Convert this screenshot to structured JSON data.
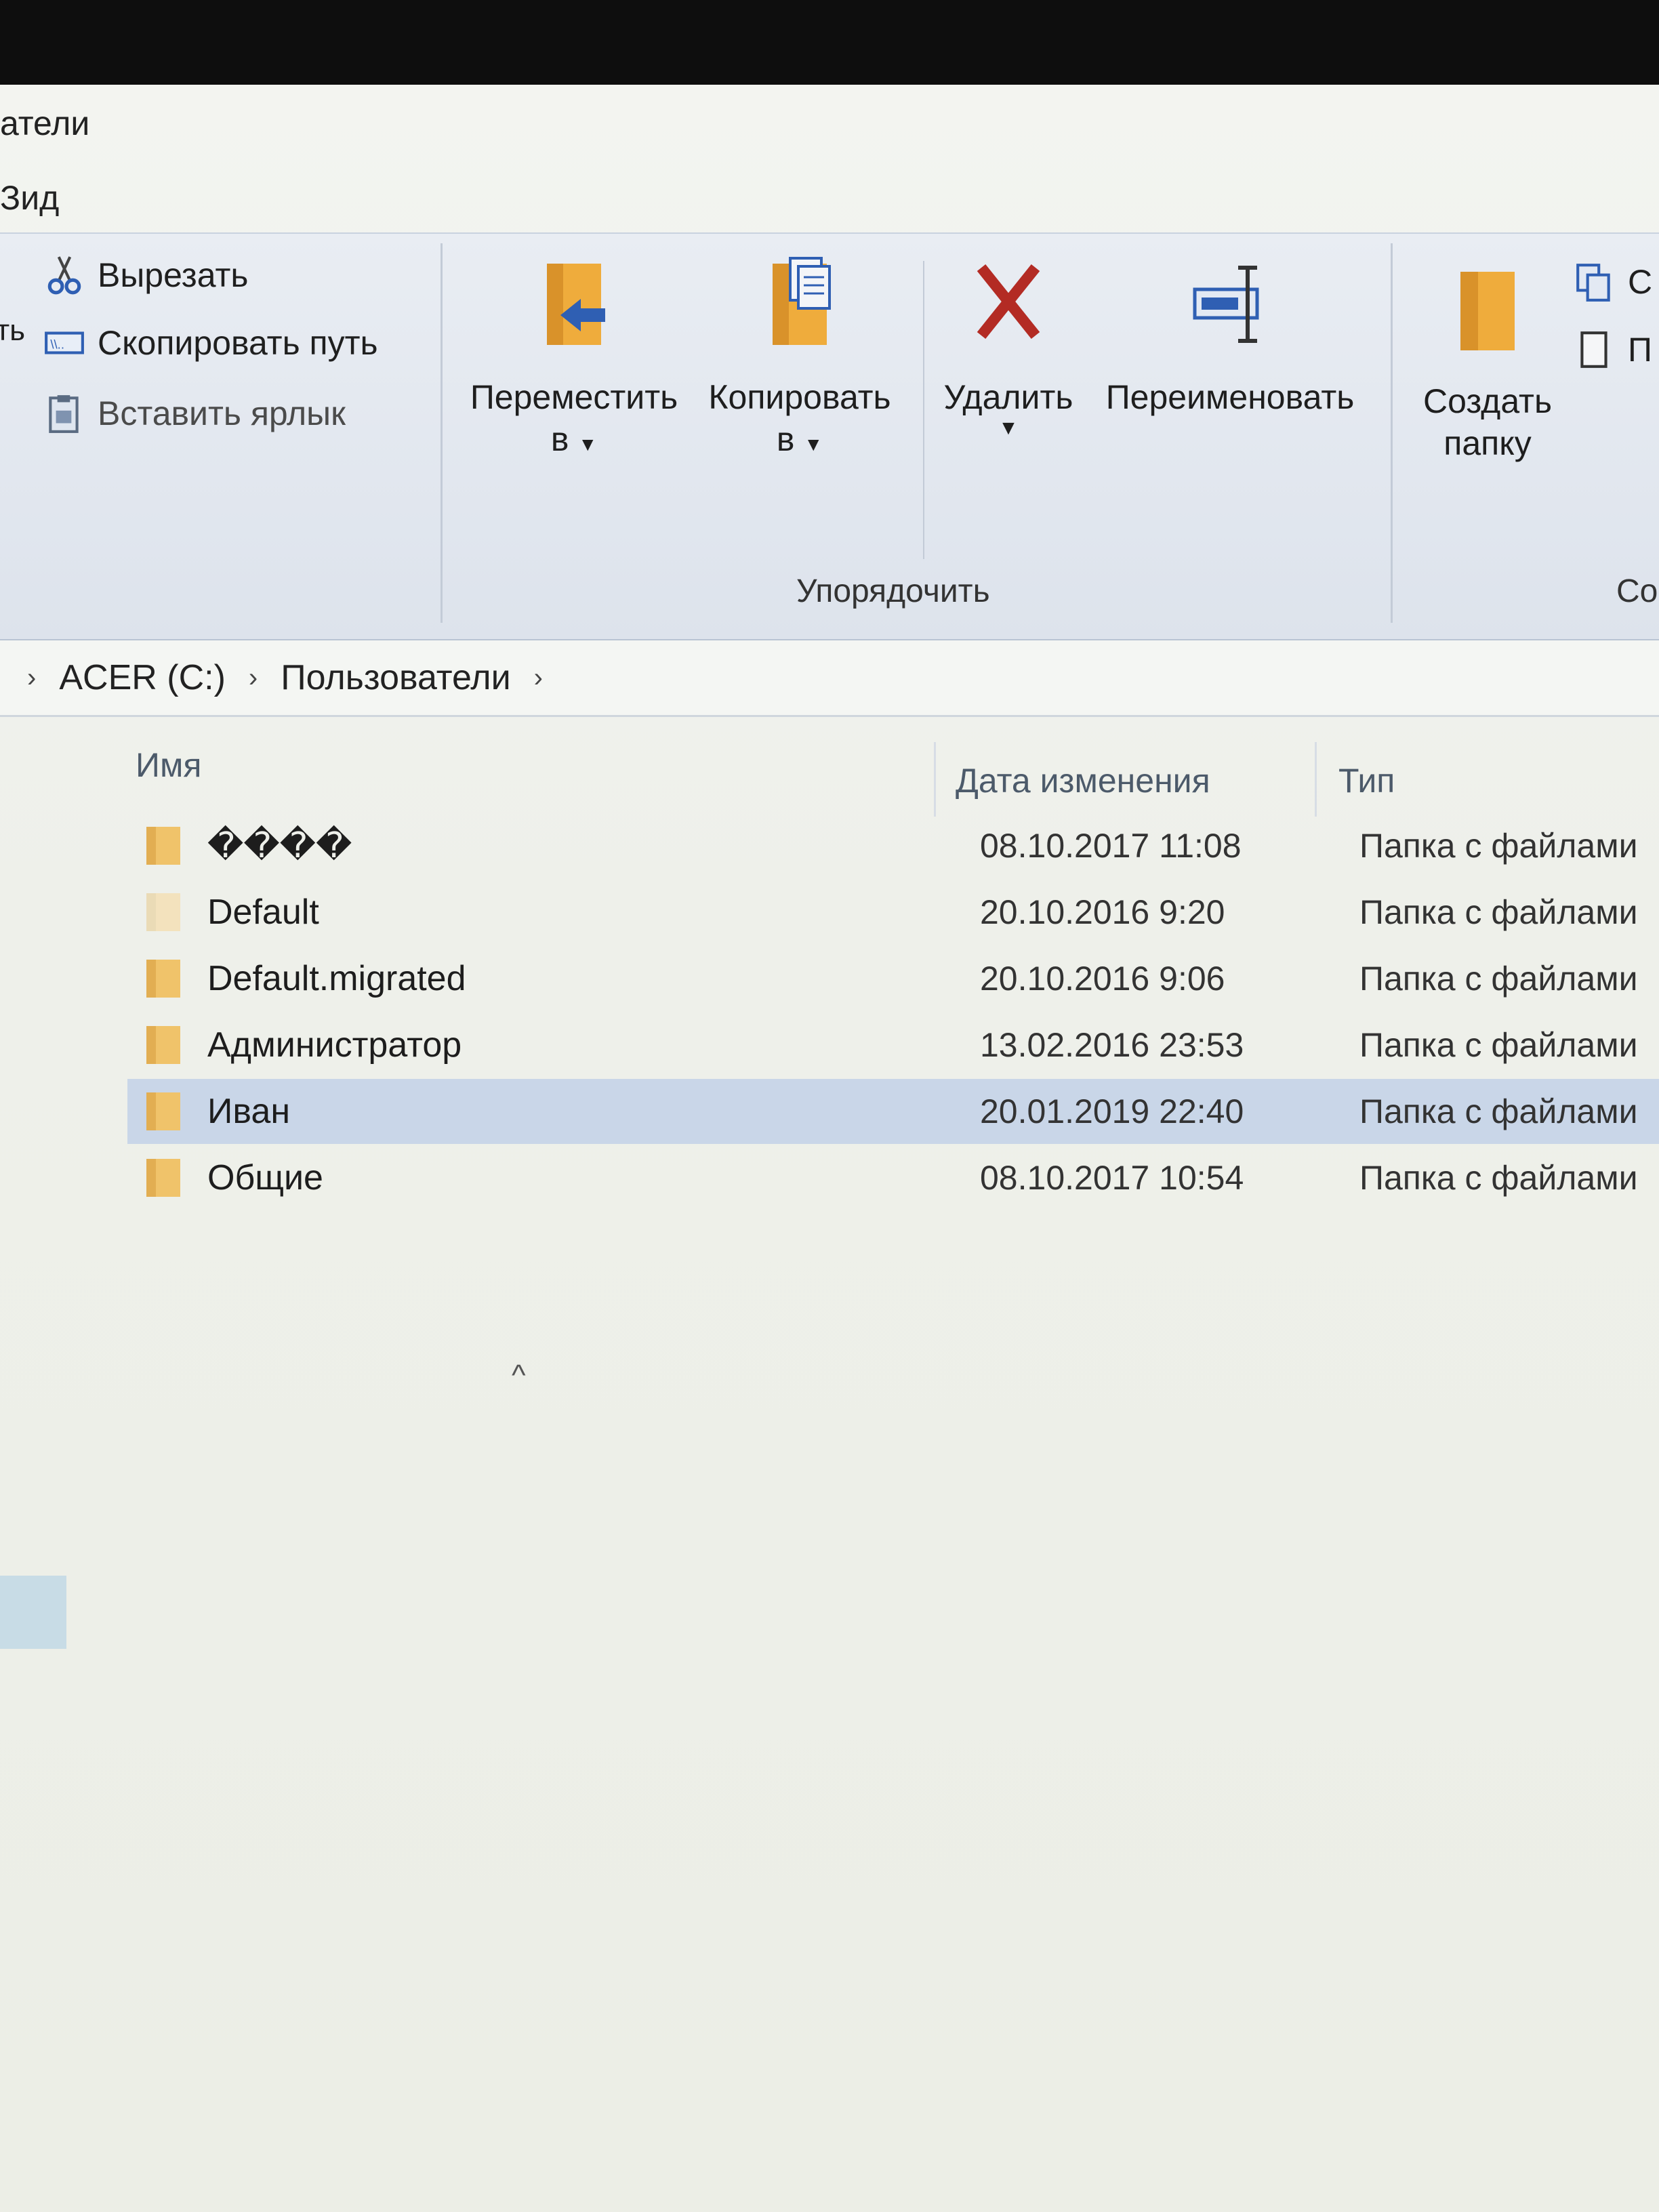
{
  "window": {
    "title_fragment": "атели",
    "tab_fragment": "Зид"
  },
  "ribbon": {
    "clipboard_partial": "ть",
    "cut_label": "Вырезать",
    "copy_path_label": "Скопировать путь",
    "paste_shortcut_label": "Вставить ярлык",
    "move_to_label_line1": "Переместить",
    "move_to_label_line2": "в",
    "copy_to_label_line1": "Копировать",
    "copy_to_label_line2": "в",
    "delete_label": "Удалить",
    "rename_label": "Переименовать",
    "new_folder_label_line1": "Создать",
    "new_folder_label_line2": "папку",
    "organize_group_label": "Упорядочить",
    "new_group_partial": "Со",
    "right_item1_partial": "С",
    "right_item2_partial": "П"
  },
  "breadcrumb": {
    "items": [
      "ACER (C:)",
      "Пользователи"
    ]
  },
  "columns": {
    "name": "Имя",
    "date": "Дата изменения",
    "type": "Тип"
  },
  "files": [
    {
      "name": "����",
      "date": "08.10.2017 11:08",
      "type": "Папка с файлами",
      "selected": false
    },
    {
      "name": "Default",
      "date": "20.10.2016 9:20",
      "type": "Папка с файлами",
      "selected": false
    },
    {
      "name": "Default.migrated",
      "date": "20.10.2016 9:06",
      "type": "Папка с файлами",
      "selected": false
    },
    {
      "name": "Администратор",
      "date": "13.02.2016 23:53",
      "type": "Папка с файлами",
      "selected": false
    },
    {
      "name": "Иван",
      "date": "20.01.2019 22:40",
      "type": "Папка с файлами",
      "selected": true
    },
    {
      "name": "Общие",
      "date": "08.10.2017 10:54",
      "type": "Папка с файлами",
      "selected": false
    }
  ],
  "colors": {
    "folder": "#f0c36a",
    "folder_faded": "#f3e2bd",
    "selection": "#c9d6e8",
    "delete_x": "#b32b24",
    "accent_blue": "#2f5fb3"
  }
}
